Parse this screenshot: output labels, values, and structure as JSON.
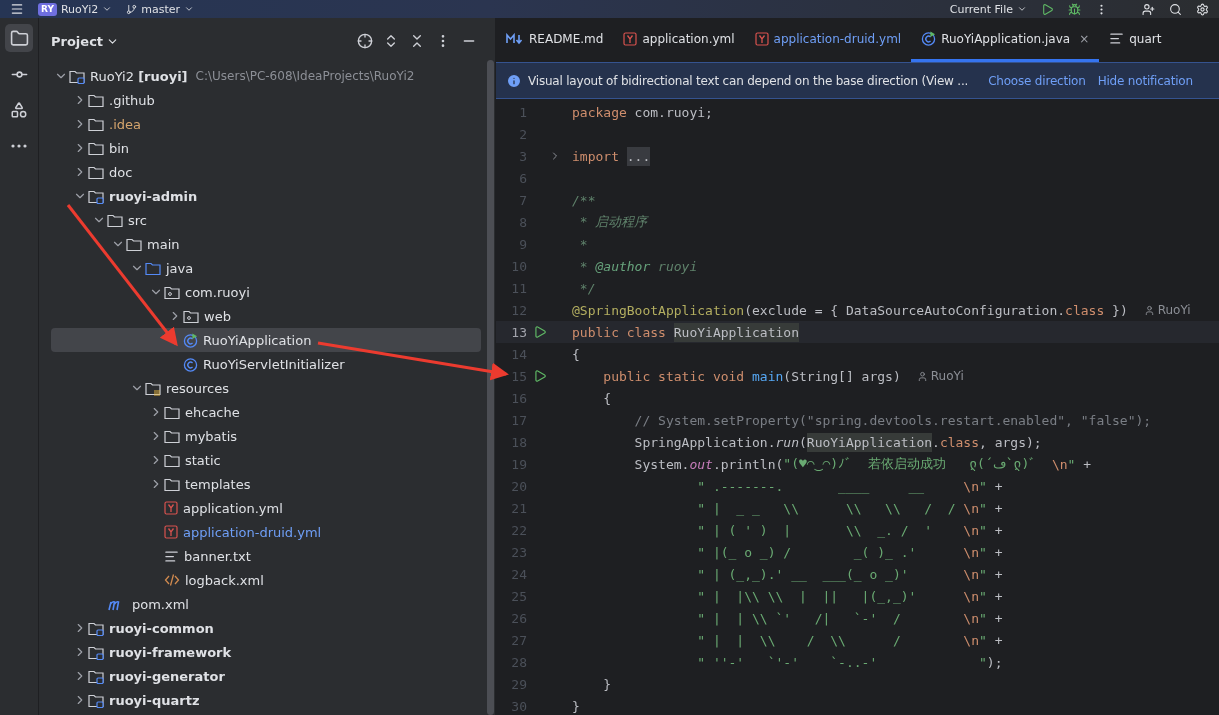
{
  "title_bar": {
    "badge": "RY",
    "project": "RuoYi2",
    "branch": "master",
    "run_config": "Current File"
  },
  "tool_strip": [
    {
      "kind": "project",
      "selected": true
    },
    {
      "kind": "commit",
      "selected": false
    },
    {
      "kind": "structure",
      "selected": false
    },
    {
      "kind": "more",
      "selected": false
    }
  ],
  "project_panel": {
    "title": "Project",
    "tree": [
      {
        "kind": "root",
        "name": "RuoYi2 **[ruoyi]**",
        "path": "C:\\Users\\PC-608\\IdeaProjects\\RuoYi2",
        "expanded": true,
        "selected": false,
        "color": "#dfe1e5",
        "children": [
          {
            "kind": "folder",
            "name": ".github",
            "expanded": false,
            "selected": false,
            "color": "#dfe1e5"
          },
          {
            "kind": "folder",
            "name": ".idea",
            "expanded": false,
            "selected": false,
            "color": "#d5a56d"
          },
          {
            "kind": "folder",
            "name": "bin",
            "expanded": false,
            "selected": false,
            "color": "#dfe1e5"
          },
          {
            "kind": "folder",
            "name": "doc",
            "expanded": false,
            "selected": false,
            "color": "#dfe1e5"
          },
          {
            "kind": "module",
            "name": "ruoyi-admin",
            "expanded": true,
            "selected": false,
            "color": "#dfe1e5",
            "children": [
              {
                "kind": "folder",
                "name": "src",
                "expanded": true,
                "selected": false,
                "color": "#dfe1e5",
                "children": [
                  {
                    "kind": "folder",
                    "name": "main",
                    "expanded": true,
                    "selected": false,
                    "color": "#dfe1e5",
                    "children": [
                      {
                        "kind": "source",
                        "name": "java",
                        "expanded": true,
                        "selected": false,
                        "color": "#dfe1e5",
                        "children": [
                          {
                            "kind": "package",
                            "name": "com.ruoyi",
                            "expanded": true,
                            "selected": false,
                            "color": "#dfe1e5",
                            "children": [
                              {
                                "kind": "package",
                                "name": "web",
                                "expanded": false,
                                "selected": false,
                                "color": "#dfe1e5"
                              },
                              {
                                "kind": "class-run",
                                "name": "RuoYiApplication",
                                "selected": true,
                                "color": "#dfe1e5"
                              },
                              {
                                "kind": "class",
                                "name": "RuoYiServletInitializer",
                                "selected": false,
                                "color": "#dfe1e5"
                              }
                            ]
                          }
                        ]
                      },
                      {
                        "kind": "resources",
                        "name": "resources",
                        "expanded": true,
                        "selected": false,
                        "color": "#dfe1e5",
                        "children": [
                          {
                            "kind": "folder",
                            "name": "ehcache",
                            "expanded": false,
                            "selected": false,
                            "color": "#dfe1e5"
                          },
                          {
                            "kind": "folder",
                            "name": "mybatis",
                            "expanded": false,
                            "selected": false,
                            "color": "#dfe1e5"
                          },
                          {
                            "kind": "folder",
                            "name": "static",
                            "expanded": false,
                            "selected": false,
                            "color": "#dfe1e5"
                          },
                          {
                            "kind": "folder",
                            "name": "templates",
                            "expanded": false,
                            "selected": false,
                            "color": "#dfe1e5"
                          },
                          {
                            "kind": "yaml",
                            "name": "application.yml",
                            "selected": false,
                            "color": "#dfe1e5"
                          },
                          {
                            "kind": "yaml",
                            "name": "application-druid.yml",
                            "selected": false,
                            "color": "#6f9ff7"
                          },
                          {
                            "kind": "text",
                            "name": "banner.txt",
                            "selected": false,
                            "color": "#dfe1e5"
                          },
                          {
                            "kind": "xml",
                            "name": "logback.xml",
                            "selected": false,
                            "color": "#dfe1e5"
                          }
                        ]
                      }
                    ]
                  }
                ]
              },
              {
                "kind": "maven",
                "name": "pom.xml",
                "selected": false,
                "color": "#dfe1e5"
              }
            ]
          },
          {
            "kind": "module",
            "name": "ruoyi-common",
            "expanded": false,
            "selected": false,
            "color": "#dfe1e5"
          },
          {
            "kind": "module",
            "name": "ruoyi-framework",
            "expanded": false,
            "selected": false,
            "color": "#dfe1e5"
          },
          {
            "kind": "module",
            "name": "ruoyi-generator",
            "expanded": false,
            "selected": false,
            "color": "#dfe1e5"
          },
          {
            "kind": "module",
            "name": "ruoyi-quartz",
            "expanded": false,
            "selected": false,
            "color": "#dfe1e5"
          }
        ]
      }
    ]
  },
  "editor_tabs": [
    {
      "kind": "markdown",
      "label": "README.md",
      "selected": false,
      "color": "#dfe1e5"
    },
    {
      "kind": "yaml",
      "label": "application.yml",
      "selected": false,
      "color": "#dfe1e5"
    },
    {
      "kind": "yaml",
      "label": "application-druid.yml",
      "selected": false,
      "color": "#6f9ff7"
    },
    {
      "kind": "class-run",
      "label": "RuoYiApplication.java",
      "selected": true,
      "color": "#dfe1e5",
      "close": "×"
    },
    {
      "kind": "text",
      "label": "quart",
      "selected": false,
      "color": "#dfe1e5"
    }
  ],
  "notification": {
    "text": "Visual layout of bidirectional text can depend on the base direction (View ...",
    "actions": [
      "Choose direction",
      "Hide notification"
    ]
  },
  "code_lines": [
    {
      "number": "1",
      "run": false,
      "fold": false,
      "current": false,
      "tokens": [
        {
          "kind": "keyword",
          "text": "package"
        },
        {
          "kind": "plain",
          "text": " com.ruoyi;"
        }
      ]
    },
    {
      "number": "2",
      "run": false,
      "fold": false,
      "current": false
    },
    {
      "number": "3",
      "run": false,
      "fold": true,
      "current": false,
      "tokens": [
        {
          "kind": "keyword",
          "text": "import "
        },
        {
          "kind": "folded",
          "text": "..."
        }
      ]
    },
    {
      "number": "6",
      "run": false,
      "fold": false,
      "current": false
    },
    {
      "number": "7",
      "run": false,
      "fold": false,
      "current": false,
      "tokens": [
        {
          "kind": "doc",
          "text": "/**"
        }
      ]
    },
    {
      "number": "8",
      "run": false,
      "fold": false,
      "current": false,
      "tokens": [
        {
          "kind": "doc",
          "text": " * 启动程序"
        }
      ]
    },
    {
      "number": "9",
      "run": false,
      "fold": false,
      "current": false,
      "tokens": [
        {
          "kind": "doc",
          "text": " *"
        }
      ]
    },
    {
      "number": "10",
      "run": false,
      "fold": false,
      "current": false,
      "tokens": [
        {
          "kind": "doc",
          "text": " * "
        },
        {
          "kind": "doctag",
          "text": "@author"
        },
        {
          "kind": "doc",
          "text": " ruoyi"
        }
      ]
    },
    {
      "number": "11",
      "run": false,
      "fold": false,
      "current": false,
      "tokens": [
        {
          "kind": "doc",
          "text": " */"
        }
      ]
    },
    {
      "number": "12",
      "run": false,
      "fold": false,
      "current": false,
      "tokens": [
        {
          "kind": "annotation",
          "text": "@SpringBootApplication"
        },
        {
          "kind": "plain",
          "text": "(exclude = { DataSourceAutoConfiguration."
        },
        {
          "kind": "keyword",
          "text": "class"
        },
        {
          "kind": "plain",
          "text": " })"
        },
        {
          "kind": "hint",
          "text": "RuoYi"
        }
      ]
    },
    {
      "number": "13",
      "run": true,
      "fold": false,
      "current": true,
      "tokens": [
        {
          "kind": "keyword",
          "text": "public class "
        },
        {
          "kind": "highlight",
          "text": "RuoYiApplication"
        }
      ]
    },
    {
      "number": "14",
      "run": false,
      "fold": false,
      "current": false,
      "tokens": [
        {
          "kind": "plain",
          "text": "{"
        }
      ]
    },
    {
      "number": "15",
      "run": true,
      "fold": false,
      "current": false,
      "tokens": [
        {
          "kind": "keyword",
          "text": "    public static void "
        },
        {
          "kind": "method",
          "text": "main"
        },
        {
          "kind": "plain",
          "text": "(String[] args)"
        },
        {
          "kind": "hint",
          "text": "RuoYi"
        }
      ]
    },
    {
      "number": "16",
      "run": false,
      "fold": false,
      "current": false,
      "tokens": [
        {
          "kind": "plain",
          "text": "    {"
        }
      ]
    },
    {
      "number": "17",
      "run": false,
      "fold": false,
      "current": false,
      "tokens": [
        {
          "kind": "comment",
          "text": "        // System.setProperty(\"spring.devtools.restart.enabled\", \"false\");"
        }
      ]
    },
    {
      "number": "18",
      "run": false,
      "fold": false,
      "current": false,
      "tokens": [
        {
          "kind": "plain",
          "text": "        SpringApplication."
        },
        {
          "kind": "call",
          "text": "run"
        },
        {
          "kind": "plain",
          "text": "("
        },
        {
          "kind": "highlight",
          "text": "RuoYiApplication"
        },
        {
          "kind": "plain",
          "text": "."
        },
        {
          "kind": "keyword",
          "text": "class"
        },
        {
          "kind": "plain",
          "text": ", args);"
        }
      ]
    },
    {
      "number": "19",
      "run": false,
      "fold": false,
      "current": false,
      "tokens": [
        {
          "kind": "plain",
          "text": "        System."
        },
        {
          "kind": "static",
          "text": "out"
        },
        {
          "kind": "plain",
          "text": ".println("
        },
        {
          "kind": "string",
          "text": "\"(♥◠‿◠)ﾉﾞ  若依启动成功   ლ(´ڡ`ლ)ﾞ  "
        },
        {
          "kind": "escape",
          "text": "\\n"
        },
        {
          "kind": "string",
          "text": "\""
        },
        {
          "kind": "plain",
          "text": " +"
        }
      ]
    },
    {
      "number": "20",
      "run": false,
      "fold": false,
      "current": false,
      "tokens": [
        {
          "kind": "string",
          "text": "                \" .-------.       ____     __     "
        },
        {
          "kind": "escape",
          "text": "\\n"
        },
        {
          "kind": "string",
          "text": "\""
        },
        {
          "kind": "plain",
          "text": " +"
        }
      ]
    },
    {
      "number": "21",
      "run": false,
      "fold": false,
      "current": false,
      "tokens": [
        {
          "kind": "string",
          "text": "                \" |  _ _   \\\\      \\\\   \\\\   /  / "
        },
        {
          "kind": "escape",
          "text": "\\n"
        },
        {
          "kind": "string",
          "text": "\""
        },
        {
          "kind": "plain",
          "text": " +"
        }
      ]
    },
    {
      "number": "22",
      "run": false,
      "fold": false,
      "current": false,
      "tokens": [
        {
          "kind": "string",
          "text": "                \" | ( ' )  |       \\\\  _. /  '    "
        },
        {
          "kind": "escape",
          "text": "\\n"
        },
        {
          "kind": "string",
          "text": "\""
        },
        {
          "kind": "plain",
          "text": " +"
        }
      ]
    },
    {
      "number": "23",
      "run": false,
      "fold": false,
      "current": false,
      "tokens": [
        {
          "kind": "string",
          "text": "                \" |(_ o _) /        _( )_ .'      "
        },
        {
          "kind": "escape",
          "text": "\\n"
        },
        {
          "kind": "string",
          "text": "\""
        },
        {
          "kind": "plain",
          "text": " +"
        }
      ]
    },
    {
      "number": "24",
      "run": false,
      "fold": false,
      "current": false,
      "tokens": [
        {
          "kind": "string",
          "text": "                \" | (_,_).' __  ___(_ o _)'       "
        },
        {
          "kind": "escape",
          "text": "\\n"
        },
        {
          "kind": "string",
          "text": "\""
        },
        {
          "kind": "plain",
          "text": " +"
        }
      ]
    },
    {
      "number": "25",
      "run": false,
      "fold": false,
      "current": false,
      "tokens": [
        {
          "kind": "string",
          "text": "                \" |  |\\\\ \\\\  |  ||   |(_,_)'      "
        },
        {
          "kind": "escape",
          "text": "\\n"
        },
        {
          "kind": "string",
          "text": "\""
        },
        {
          "kind": "plain",
          "text": " +"
        }
      ]
    },
    {
      "number": "26",
      "run": false,
      "fold": false,
      "current": false,
      "tokens": [
        {
          "kind": "string",
          "text": "                \" |  | \\\\ `'   /|   `-'  /        "
        },
        {
          "kind": "escape",
          "text": "\\n"
        },
        {
          "kind": "string",
          "text": "\""
        },
        {
          "kind": "plain",
          "text": " +"
        }
      ]
    },
    {
      "number": "27",
      "run": false,
      "fold": false,
      "current": false,
      "tokens": [
        {
          "kind": "string",
          "text": "                \" |  |  \\\\    /  \\\\      /        "
        },
        {
          "kind": "escape",
          "text": "\\n"
        },
        {
          "kind": "string",
          "text": "\""
        },
        {
          "kind": "plain",
          "text": " +"
        }
      ]
    },
    {
      "number": "28",
      "run": false,
      "fold": false,
      "current": false,
      "tokens": [
        {
          "kind": "string",
          "text": "                \" ''-'   `'-'    `-..-'             \""
        },
        {
          "kind": "plain",
          "text": ");"
        }
      ]
    },
    {
      "number": "29",
      "run": false,
      "fold": false,
      "current": false,
      "tokens": [
        {
          "kind": "plain",
          "text": "    }"
        }
      ]
    },
    {
      "number": "30",
      "run": false,
      "fold": false,
      "current": false,
      "tokens": [
        {
          "kind": "plain",
          "text": "}"
        }
      ]
    }
  ],
  "annotations": [
    {
      "kind": "arrow"
    },
    {
      "kind": "arrow"
    }
  ]
}
